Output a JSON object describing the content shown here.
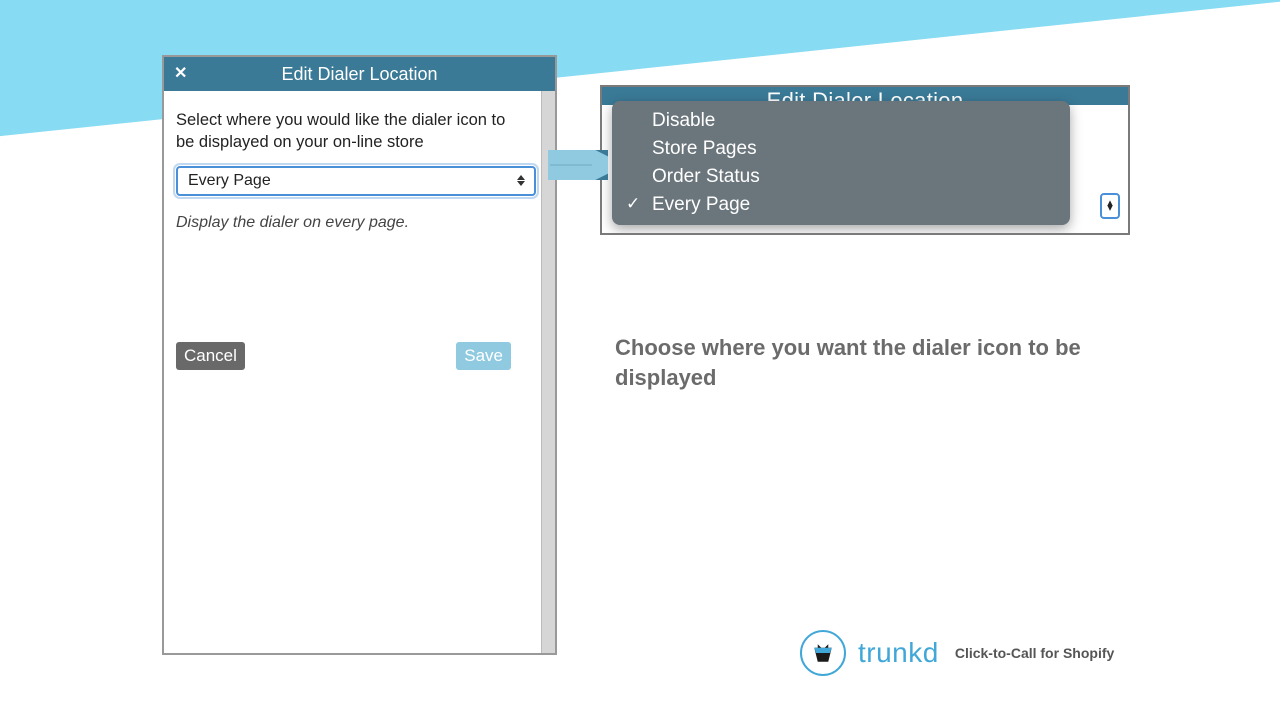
{
  "dialog": {
    "title": "Edit Dialer Location",
    "instruction": "Select where you would like the dialer icon to be displayed on your on-line store",
    "select_value": "Every Page",
    "helper": "Display the dialer on every page.",
    "cancel_label": "Cancel",
    "save_label": "Save"
  },
  "dropdown": {
    "header_title_clipped": "Edit Dialer Location",
    "options": [
      {
        "label": "Disable",
        "selected": false
      },
      {
        "label": "Store Pages",
        "selected": false
      },
      {
        "label": "Order Status",
        "selected": false
      },
      {
        "label": "Every Page",
        "selected": true
      }
    ]
  },
  "caption": "Choose where you want the dialer icon to be displayed",
  "brand": {
    "name": "trunkd",
    "tagline": "Click-to-Call for Shopify"
  }
}
